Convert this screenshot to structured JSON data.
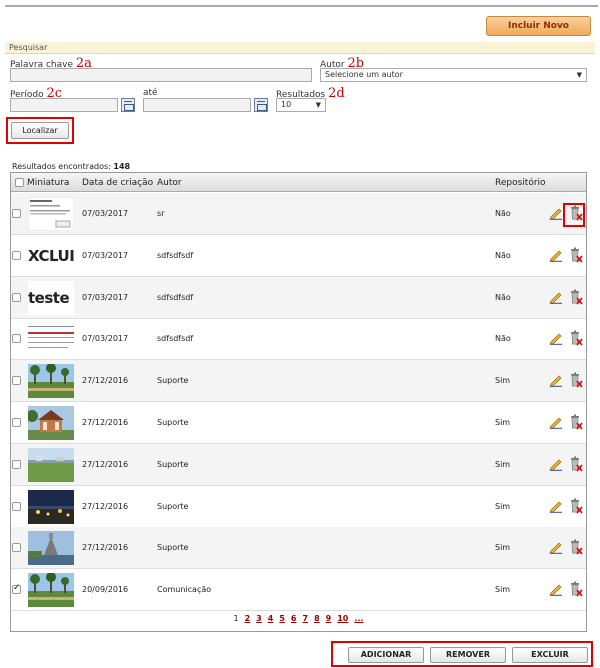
{
  "header": {
    "include_new_label": "Incluir Novo"
  },
  "search": {
    "section_title": "Pesquisar",
    "keyword_label": "Palavra chave",
    "keyword_value": "",
    "author_label": "Autor",
    "author_selected": "Selecione um autor",
    "period_label": "Período",
    "period_to_label": "até",
    "results_label": "Resultados",
    "results_selected": "10",
    "search_button": "Localizar",
    "annotations": {
      "keyword": "2a",
      "author": "2b",
      "period": "2c",
      "results": "2d"
    }
  },
  "results": {
    "found_label": "Resultados encontrados:",
    "found_count": "148"
  },
  "table": {
    "columns": [
      "Miniatura",
      "Data de criação",
      "Autor",
      "Repositório"
    ],
    "rows": [
      {
        "date": "07/03/2017",
        "author": "sr",
        "repository": "Não",
        "checked": false,
        "thumb": "document"
      },
      {
        "date": "07/03/2017",
        "author": "sdfsdfsdf",
        "repository": "Não",
        "checked": false,
        "thumb": "text",
        "thumb_text": "XCLUI"
      },
      {
        "date": "07/03/2017",
        "author": "sdfsdfsdf",
        "repository": "Não",
        "checked": false,
        "thumb": "text",
        "thumb_text": "teste"
      },
      {
        "date": "07/03/2017",
        "author": "sdfsdfsdf",
        "repository": "Não",
        "checked": false,
        "thumb": "lines"
      },
      {
        "date": "27/12/2016",
        "author": "Suporte",
        "repository": "Sim",
        "checked": false,
        "thumb": "palms"
      },
      {
        "date": "27/12/2016",
        "author": "Suporte",
        "repository": "Sim",
        "checked": false,
        "thumb": "kiosk"
      },
      {
        "date": "27/12/2016",
        "author": "Suporte",
        "repository": "Sim",
        "checked": false,
        "thumb": "field"
      },
      {
        "date": "27/12/2016",
        "author": "Suporte",
        "repository": "Sim",
        "checked": false,
        "thumb": "night"
      },
      {
        "date": "27/12/2016",
        "author": "Suporte",
        "repository": "Sim",
        "checked": false,
        "thumb": "statue"
      },
      {
        "date": "20/09/2016",
        "author": "Comunicação",
        "repository": "Sim",
        "checked": true,
        "thumb": "palms"
      }
    ]
  },
  "pagination": {
    "current": "1",
    "pages": [
      "2",
      "3",
      "4",
      "5",
      "6",
      "7",
      "8",
      "9",
      "10",
      "..."
    ]
  },
  "footer": {
    "add_label": "ADICIONAR",
    "remove_label": "REMOVER",
    "delete_label": "EXCLUIR"
  },
  "colors": {
    "highlight": "#e00000",
    "annotation": "#cc0000",
    "include_button": "#eeaa5a"
  }
}
